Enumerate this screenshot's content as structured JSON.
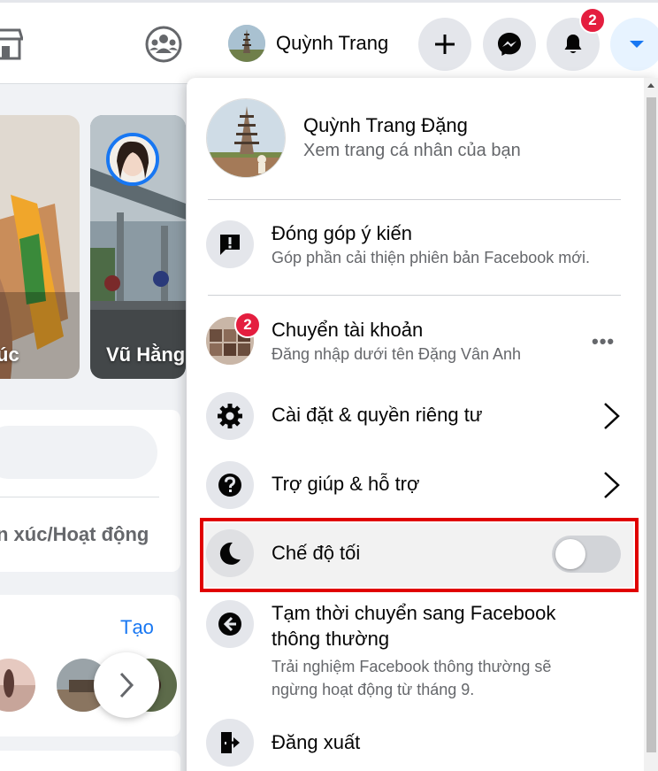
{
  "header": {
    "profile_name": "Quỳnh Trang",
    "notification_count": "2"
  },
  "feed": {
    "stories": [
      {
        "name": "úc"
      },
      {
        "name": "Vũ Hằng"
      }
    ],
    "composer_feeling": "n xúc/Hoạt động",
    "rooms_create_link": "Tạo"
  },
  "menu": {
    "profile": {
      "name": "Quỳnh Trang Đặng",
      "subtitle": "Xem trang cá nhân của bạn"
    },
    "feedback": {
      "title": "Đóng góp ý kiến",
      "subtitle": "Góp phần cải thiện phiên bản Facebook mới."
    },
    "switch_account": {
      "title": "Chuyển tài khoản",
      "subtitle": "Đăng nhập dưới tên Đặng Vân Anh",
      "badge": "2"
    },
    "settings": {
      "title": "Cài đặt & quyền riêng tư"
    },
    "help": {
      "title": "Trợ giúp & hỗ trợ"
    },
    "dark_mode": {
      "title": "Chế độ tối",
      "enabled": false
    },
    "classic": {
      "title_line1": "Tạm thời chuyển sang Facebook",
      "title_line2": "thông thường",
      "subtitle_line1": "Trải nghiệm Facebook thông thường sẽ",
      "subtitle_line2": "ngừng hoạt động từ tháng 9."
    },
    "logout": {
      "title": "Đăng xuất"
    }
  },
  "colors": {
    "accent": "#1877f2",
    "badge": "#e41e3f",
    "highlight_border": "#e00000"
  }
}
